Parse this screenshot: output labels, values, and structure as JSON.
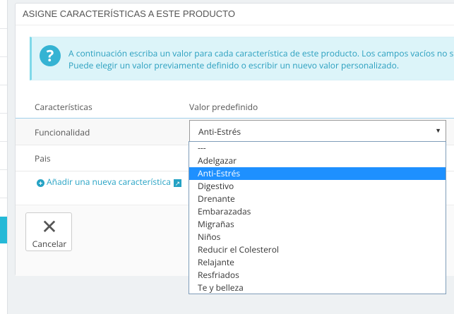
{
  "panel": {
    "title": "ASIGNE CARACTERÍSTICAS A ESTE PRODUCTO"
  },
  "alert": {
    "line1": "A continuación escriba un valor para cada característica de este producto. Los campos vacíos no se",
    "line2": "Puede elegir un valor previamente definido o escribir un nuevo valor personalizado."
  },
  "table": {
    "headers": [
      "Características",
      "Valor predefinido"
    ],
    "rows": [
      {
        "feature": "Funcionalidad",
        "selected": "Anti-Estrés"
      },
      {
        "feature": "Pais"
      }
    ]
  },
  "add_feature_label": "Añadir una nueva característica",
  "cancel_label": "Cancelar",
  "dropdown": {
    "options": [
      "---",
      "Adelgazar",
      "Anti-Estrés",
      "Digestivo",
      "Drenante",
      "Embarazadas",
      "Migrañas",
      "Niños",
      "Reducir el Colesterol",
      "Relajante",
      "Resfriados",
      "Te y belleza"
    ],
    "highlighted_index": 2
  },
  "colors": {
    "accent": "#25b9d7",
    "highlight": "#1e90ff",
    "alert_bg": "#dcf4f9"
  }
}
